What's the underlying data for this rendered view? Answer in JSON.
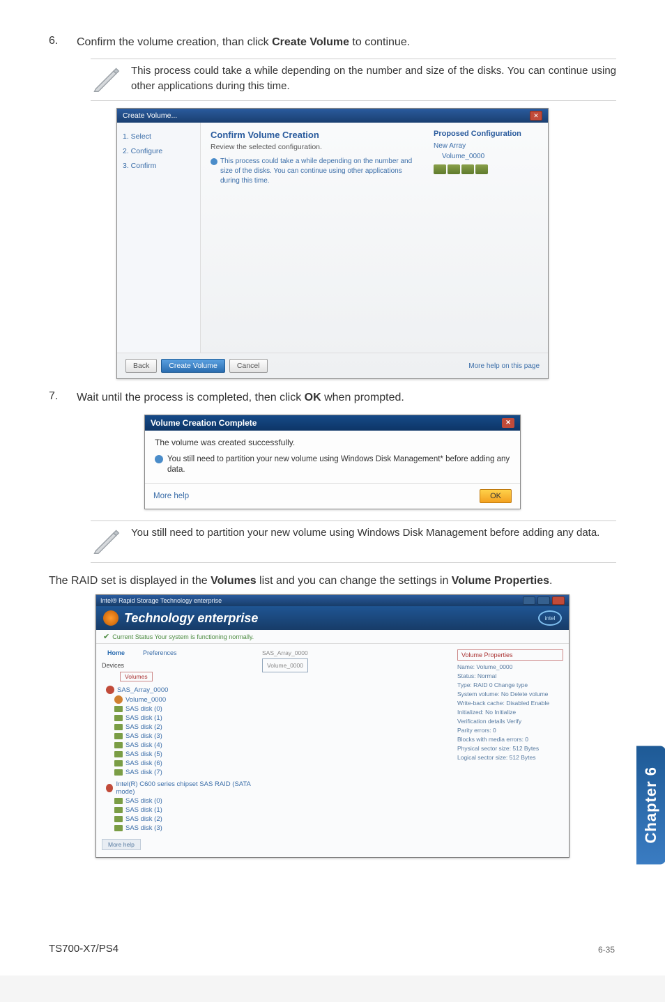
{
  "step6": {
    "num": "6.",
    "text_before": "Confirm the volume creation, than click ",
    "button": "Create Volume",
    "text_after": " to continue."
  },
  "note1": "This process could take a while depending on the number and size of the disks. You can continue using other applications during this time.",
  "dlg1": {
    "title": "Create Volume...",
    "side1": "1. Select",
    "side2": "2. Configure",
    "side3": "3. Confirm",
    "heading": "Confirm Volume Creation",
    "sub": "Review the selected configuration.",
    "info": "This process could take a while depending on the number and size of the disks. You can continue using other applications during this time.",
    "proposed": "Proposed Configuration",
    "new_array": "New Array",
    "volume": "Volume_0000",
    "back": "Back",
    "create": "Create Volume",
    "cancel": "Cancel",
    "help": "More help on this page"
  },
  "step7": {
    "num": "7.",
    "text_before": "Wait until the process is completed, then click ",
    "button": "OK",
    "text_after": " when prompted."
  },
  "dlg2": {
    "title": "Volume Creation Complete",
    "msg1": "The volume was created successfully.",
    "msg2": "You still need to partition your new volume using Windows Disk Management* before adding any data.",
    "more": "More help",
    "ok": "OK"
  },
  "note2": "You still need to partition your new volume using Windows Disk Management before adding any data.",
  "paragraph": {
    "t1": "The RAID set is displayed in the ",
    "b1": "Volumes",
    "t2": " list and you can change the settings in ",
    "b2": "Volume Properties",
    "t3": "."
  },
  "dlg3": {
    "title": "Intel® Rapid Storage Technology enterprise",
    "banner_sub": "Technology enterprise",
    "intel": "intel",
    "status": "Current Status Your system is functioning normally.",
    "tab_home": "Home",
    "tab_pref": "Preferences",
    "devices": "Devices",
    "volumes_label": "Volumes",
    "array_label": "SAS_Array_0000",
    "volume_item": "Volume_0000",
    "disk1": "SAS disk (0)",
    "disk2": "SAS disk (1)",
    "disk3": "SAS disk (2)",
    "disk4": "SAS disk (3)",
    "disk5": "SAS disk (4)",
    "disk6": "SAS disk (5)",
    "disk7": "SAS disk (6)",
    "disk8": "SAS disk (7)",
    "ctrl": "Intel(R) C600 series chipset SAS RAID (SATA mode)",
    "ctrl_d1": "SAS disk (0)",
    "ctrl_d2": "SAS disk (1)",
    "ctrl_d3": "SAS disk (2)",
    "ctrl_d4": "SAS disk (3)",
    "center_r1": "SAS_Array_0000",
    "center_r2": "Volume_0000",
    "vp_head": "Volume Properties",
    "vp1": "Name: Volume_0000",
    "vp2": "Status: Normal",
    "vp3": "Type: RAID 0 Change type",
    "vp4": "System volume: No  Delete volume",
    "vp5": "Write-back cache: Disabled Enable",
    "vp6": "Initialized: No  Initialize",
    "vp7": "Verification details  Verify",
    "vp8": "Parity errors: 0",
    "vp9": "Blocks with media errors: 0",
    "vp10": "Physical sector size: 512 Bytes",
    "vp11": "Logical sector size: 512 Bytes",
    "more_help": "More help"
  },
  "chapter": "Chapter 6",
  "footer_left": "TS700-X7/PS4",
  "footer_right": "6-35"
}
